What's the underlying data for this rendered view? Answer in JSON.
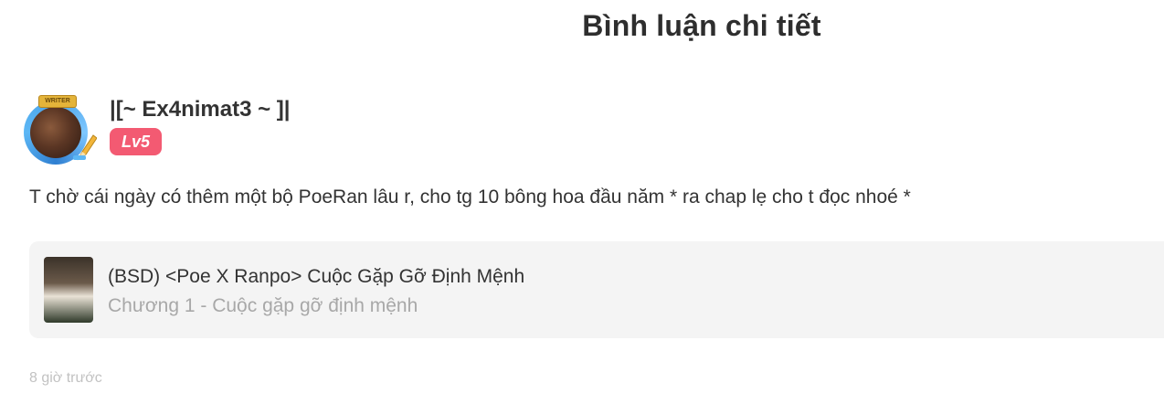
{
  "page": {
    "title": "Bình luận chi tiết"
  },
  "comment": {
    "author": {
      "name": "|[~ Ex4nimat3 ~ ]|",
      "level": "Lv5",
      "avatar_badge_text": "WRITER"
    },
    "text": "T chờ cái ngày có thêm một bộ PoeRan lâu r, cho tg 10 bông hoa đầu năm * ra chap lẹ cho t đọc nhoé *",
    "story": {
      "title": "(BSD) <Poe X Ranpo> Cuộc Gặp Gỡ Định Mệnh",
      "chapter": "Chương 1 - Cuộc gặp gỡ định mệnh"
    },
    "timestamp": "8 giờ trước"
  },
  "colors": {
    "level_badge": "#f35a72",
    "card_background": "#f4f4f4",
    "muted_text": "#a8a8a8",
    "timestamp_text": "#c2c2c2"
  },
  "icons": {
    "avatar_pen": "pen-icon"
  }
}
